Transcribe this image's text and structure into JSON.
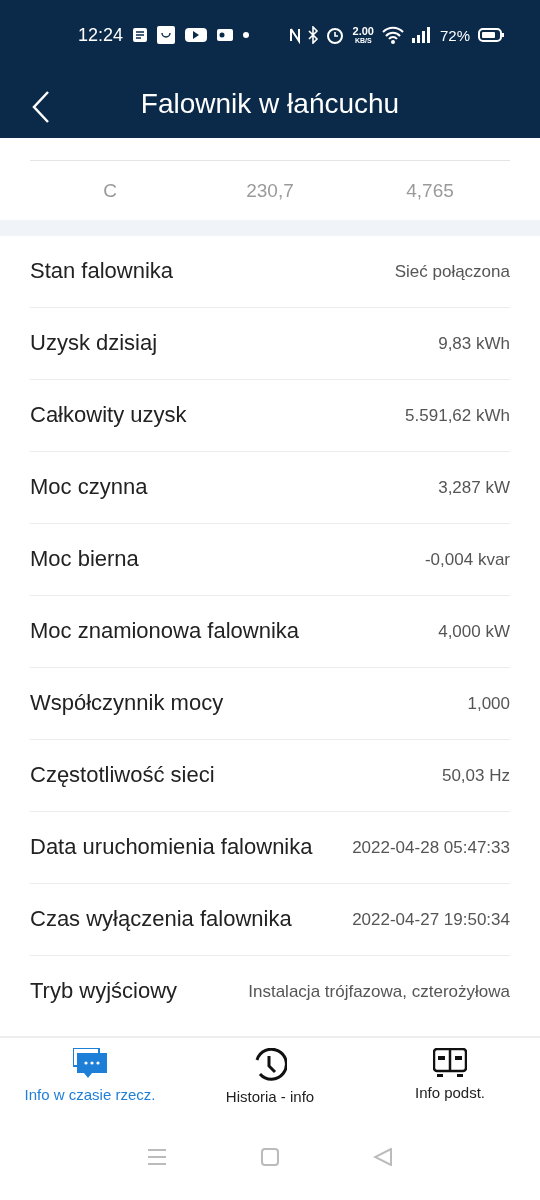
{
  "status_bar": {
    "time": "12:24",
    "speed_value": "2.00",
    "speed_unit": "KB/S",
    "battery": "72%"
  },
  "header": {
    "title": "Falownik w łańcuchu"
  },
  "phase_table": {
    "rows": [
      {
        "phase": "C",
        "voltage": "230,7",
        "current": "4,765"
      }
    ]
  },
  "details": [
    {
      "label": "Stan falownika",
      "value": "Sieć połączona"
    },
    {
      "label": "Uzysk dzisiaj",
      "value": "9,83 kWh"
    },
    {
      "label": "Całkowity uzysk",
      "value": "5.591,62 kWh"
    },
    {
      "label": "Moc czynna",
      "value": "3,287 kW"
    },
    {
      "label": "Moc bierna",
      "value": "-0,004 kvar"
    },
    {
      "label": "Moc znamionowa falownika",
      "value": "4,000 kW"
    },
    {
      "label": "Współczynnik mocy",
      "value": "1,000"
    },
    {
      "label": "Częstotliwość sieci",
      "value": "50,03 Hz"
    },
    {
      "label": "Data uruchomienia falownika",
      "value": "2022-04-28 05:47:33"
    },
    {
      "label": "Czas wyłączenia falownika",
      "value": "2022-04-27 19:50:34"
    },
    {
      "label": "Tryb wyjściowy",
      "value": "Instalacja trójfazowa, czterożyłowa"
    }
  ],
  "tabs": [
    {
      "label": "Info w czasie rzecz.",
      "kind": "chat",
      "selected": true
    },
    {
      "label": "Historia - info",
      "kind": "history",
      "selected": false
    },
    {
      "label": "Info podst.",
      "kind": "device",
      "selected": false
    }
  ]
}
